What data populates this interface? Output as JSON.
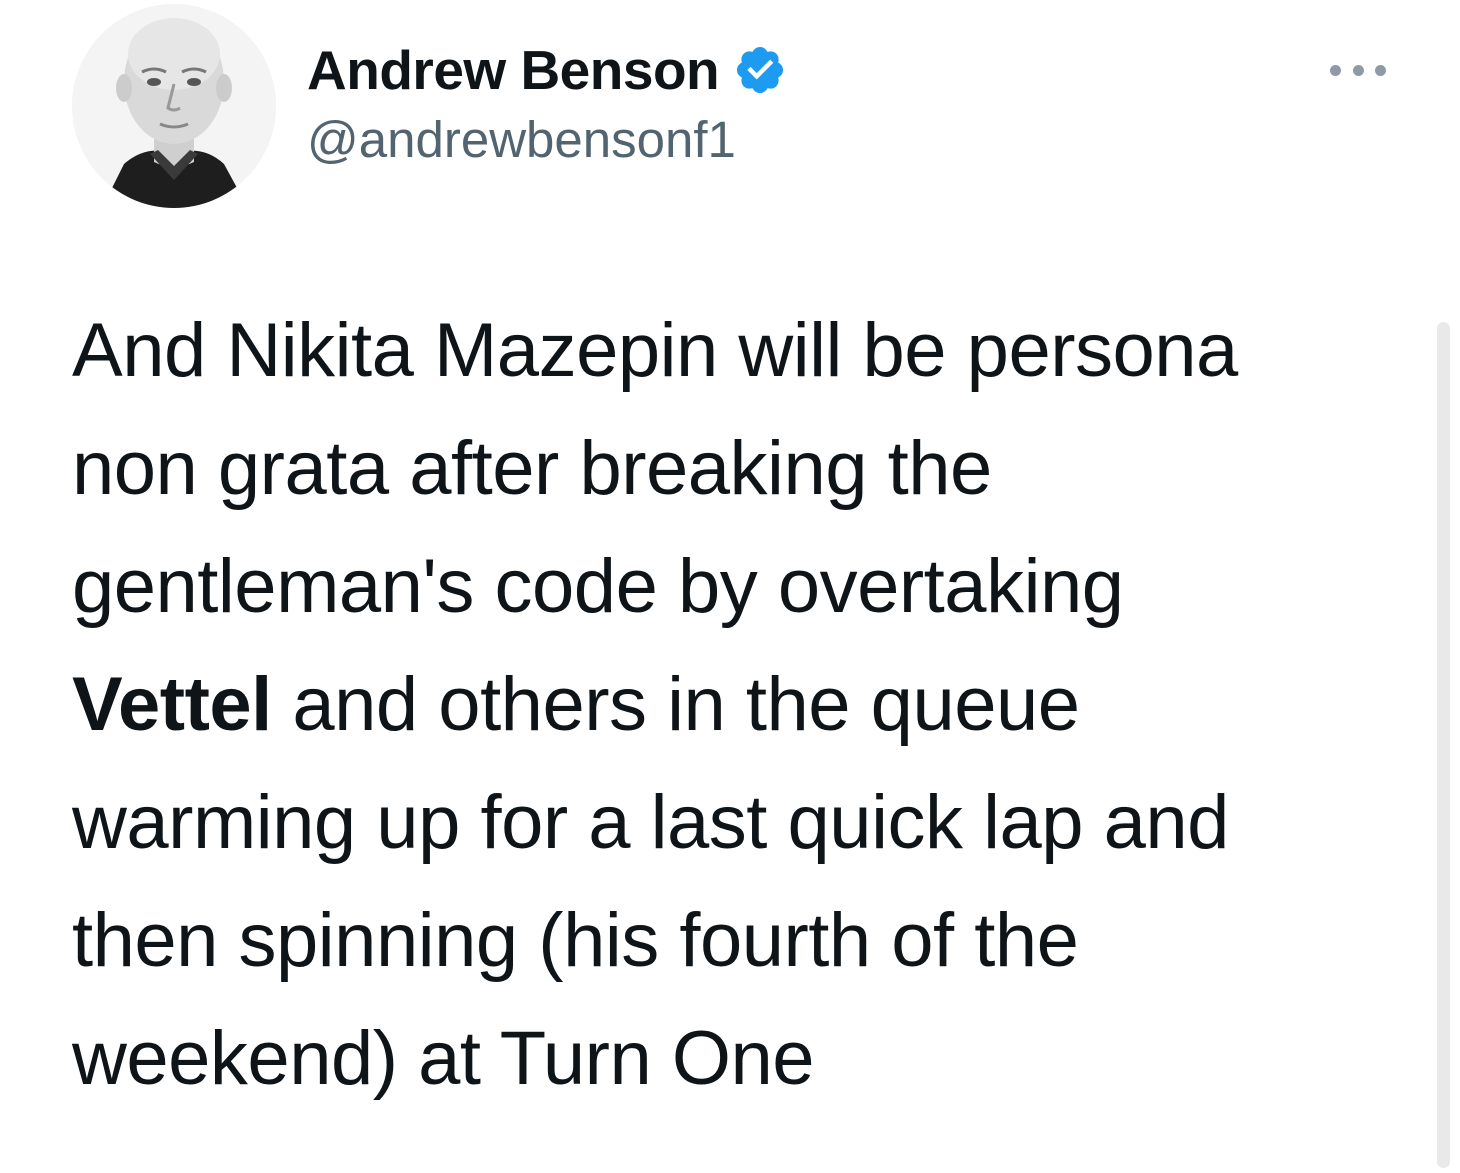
{
  "author": {
    "display_name": "Andrew Benson",
    "handle": "@andrewbensonf1",
    "verified": true,
    "verified_color": "#1d9bf0"
  },
  "icons": {
    "verified": "verified-badge-icon",
    "more": "more-options-icon"
  },
  "tweet": {
    "lines": [
      {
        "text": "And Nikita Mazepin will be persona"
      },
      {
        "text": "non grata after breaking the"
      },
      {
        "text": "gentleman's code by overtaking"
      },
      {
        "bold": "Vettel",
        "text": " and others in the queue"
      },
      {
        "text": "warming up for a last quick lap and"
      },
      {
        "text": "then spinning (his fourth of the"
      },
      {
        "text": "weekend) at Turn One"
      }
    ]
  },
  "colors": {
    "text_primary": "#0f1419",
    "text_secondary": "#536471",
    "background": "#ffffff"
  }
}
